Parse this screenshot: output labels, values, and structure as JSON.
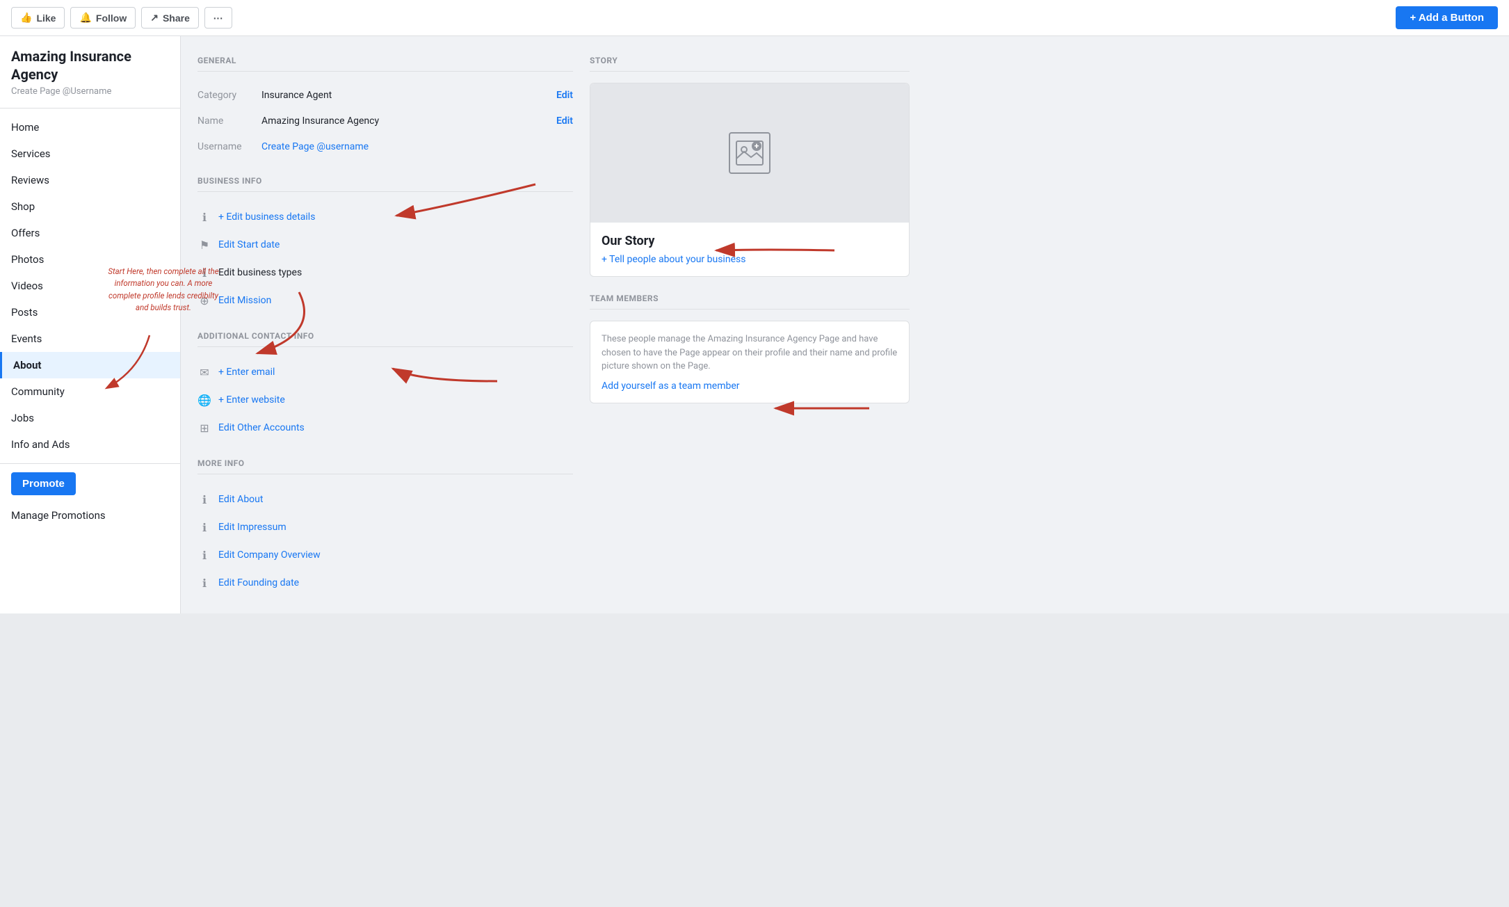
{
  "page": {
    "name": "Amazing Insurance Agency",
    "username_label": "Create Page @Username",
    "title": "Amazing Insurance Agency"
  },
  "topbar": {
    "like_label": "Like",
    "follow_label": "Follow",
    "share_label": "Share",
    "more_label": "···",
    "add_button_label": "+ Add a Button"
  },
  "sidebar": {
    "items": [
      {
        "label": "Home",
        "active": false
      },
      {
        "label": "Services",
        "active": false
      },
      {
        "label": "Reviews",
        "active": false
      },
      {
        "label": "Shop",
        "active": false
      },
      {
        "label": "Offers",
        "active": false
      },
      {
        "label": "Photos",
        "active": false
      },
      {
        "label": "Videos",
        "active": false
      },
      {
        "label": "Posts",
        "active": false
      },
      {
        "label": "Events",
        "active": false
      },
      {
        "label": "About",
        "active": true
      },
      {
        "label": "Community",
        "active": false
      },
      {
        "label": "Jobs",
        "active": false
      },
      {
        "label": "Info and Ads",
        "active": false
      }
    ],
    "promote_label": "Promote",
    "manage_promotions_label": "Manage Promotions",
    "annotation_text": "Start Here, then complete all the information you can. A more complete profile lends credibilty and builds trust."
  },
  "general": {
    "section_label": "GENERAL",
    "category_label": "Category",
    "category_value": "Insurance Agent",
    "category_edit": "Edit",
    "name_label": "Name",
    "name_value": "Amazing Insurance Agency",
    "name_edit": "Edit",
    "username_label": "Username",
    "username_value": "Create Page @username"
  },
  "business_info": {
    "section_label": "BUSINESS INFO",
    "edit_details": "+ Edit business details",
    "edit_start_date": "Edit Start date",
    "edit_types": "Edit business types",
    "edit_mission": "Edit Mission"
  },
  "additional_contact": {
    "section_label": "ADDITIONAL CONTACT INFO",
    "enter_email": "+ Enter email",
    "enter_website": "+ Enter website",
    "edit_accounts": "Edit Other Accounts"
  },
  "more_info": {
    "section_label": "MORE INFO",
    "edit_about": "Edit About",
    "edit_impressum": "Edit Impressum",
    "edit_company_overview": "Edit Company Overview",
    "edit_founding_date": "Edit Founding date"
  },
  "story": {
    "section_label": "STORY",
    "story_title": "Our Story",
    "story_cta": "+ Tell people about your business"
  },
  "team": {
    "section_label": "TEAM MEMBERS",
    "description": "These people manage the Amazing Insurance Agency Page and have chosen to have the Page appear on their profile and their name and profile picture shown on the Page.",
    "add_link": "Add yourself as a team member"
  }
}
